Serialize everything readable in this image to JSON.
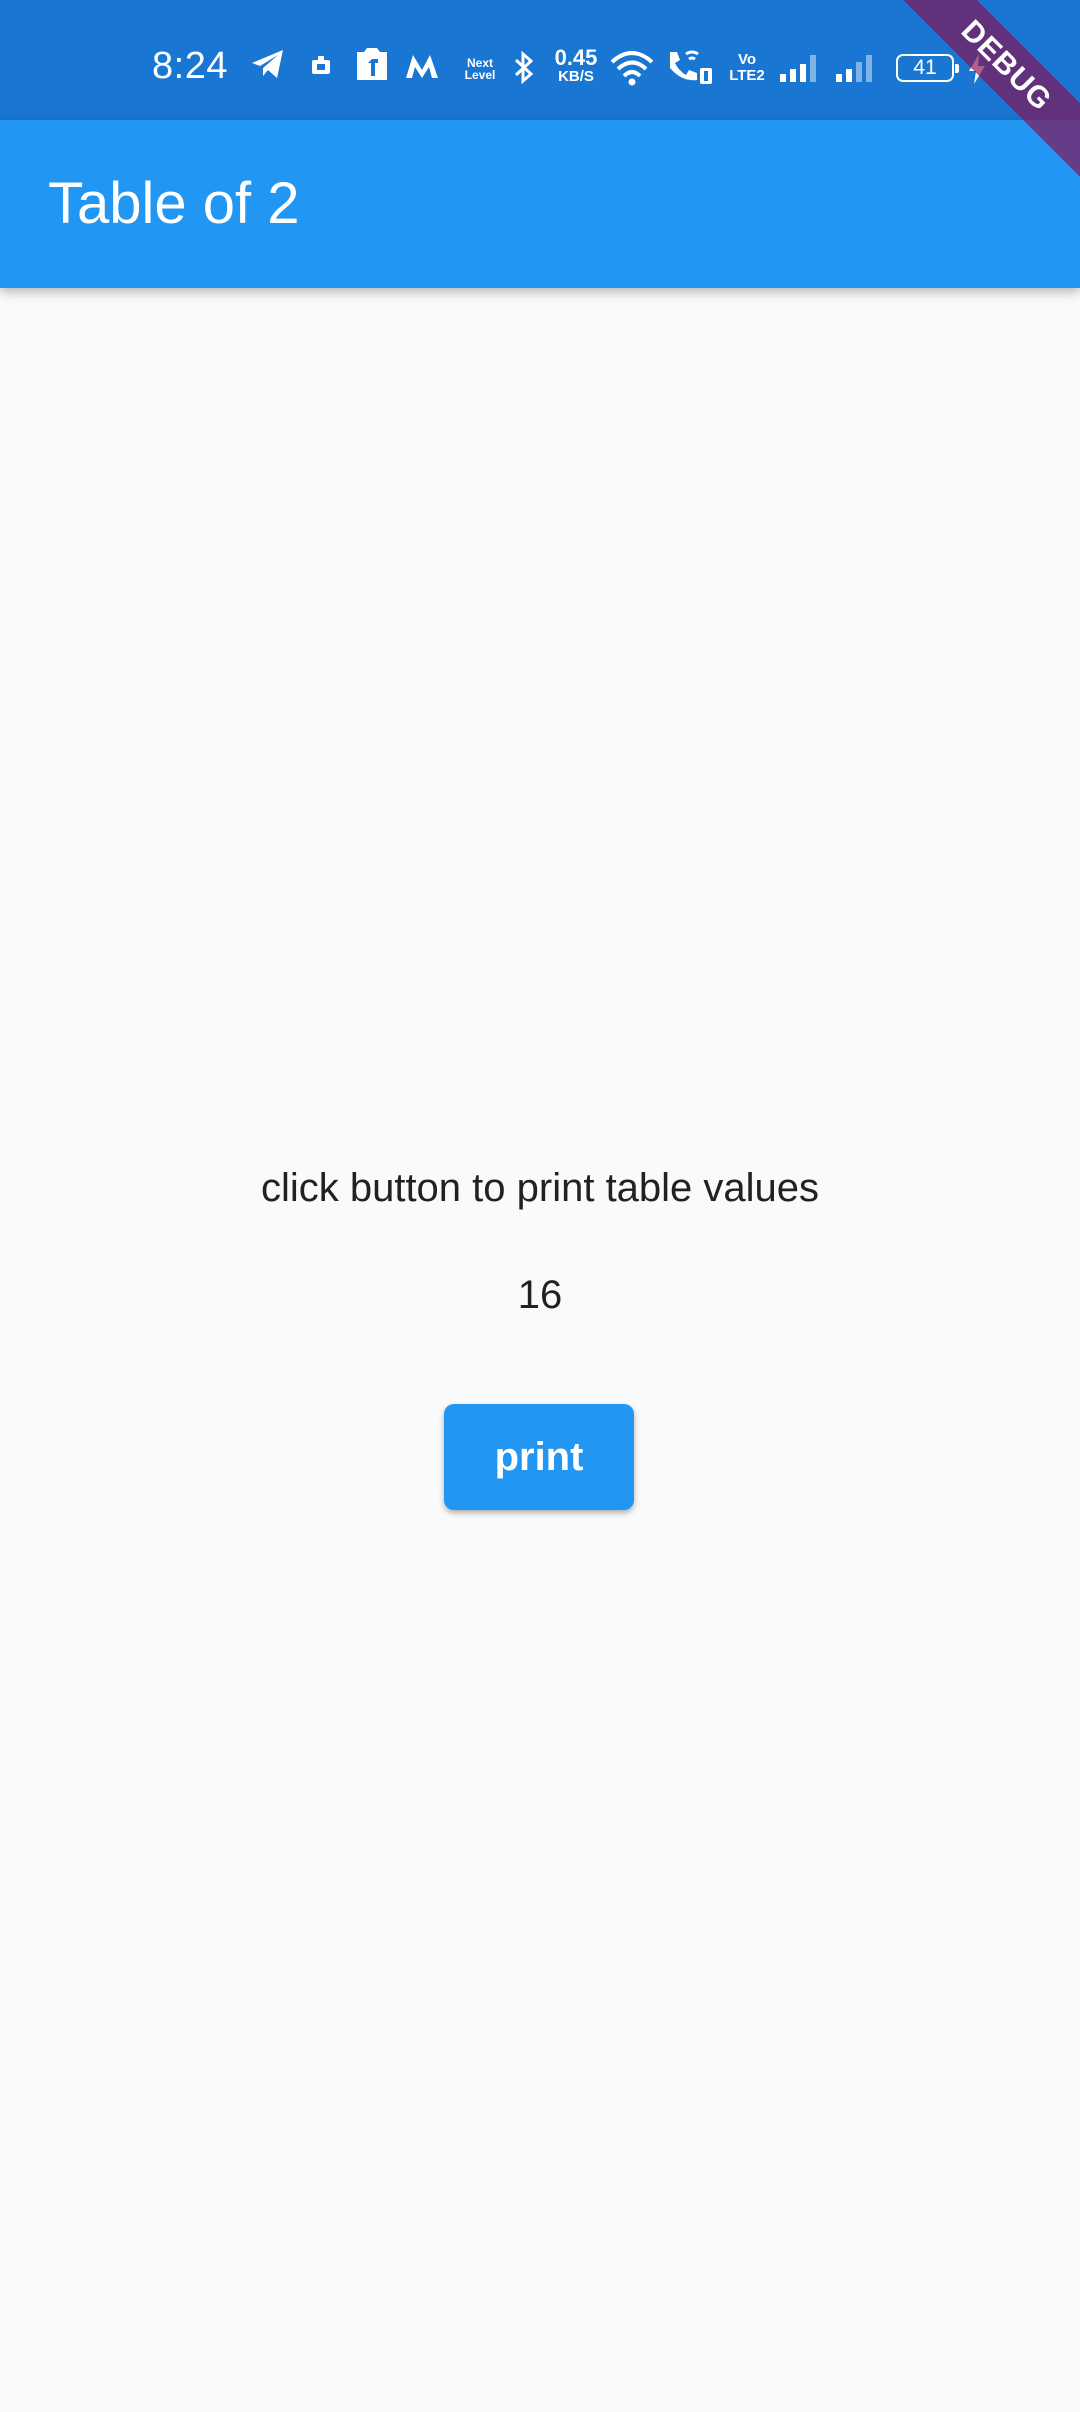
{
  "status_bar": {
    "time": "8:24",
    "net_speed_value": "0.45",
    "net_speed_unit": "KB/S",
    "next_level_line1": "Next",
    "next_level_line2": "Level",
    "volte_line1": "Vo",
    "volte_line2": "LTE2",
    "battery_level": "41",
    "icons": [
      "telegram-icon",
      "notification-icon",
      "app-icon",
      "myntra-icon",
      "next-level-icon",
      "bluetooth-icon",
      "wifi-icon",
      "wifi-calling-icon",
      "signal-icon",
      "signal-icon",
      "battery-icon",
      "charging-icon"
    ]
  },
  "app_bar": {
    "title": "Table of 2"
  },
  "debug_banner": {
    "label": "DEBUG"
  },
  "main": {
    "instruction": "click  button to print table values",
    "value": "16",
    "print_button_label": "print"
  },
  "colors": {
    "status_bar": "#1976d2",
    "app_bar": "#2196f3",
    "background": "#fafafa",
    "button": "#2196f3",
    "debug_ribbon": "#880e4f"
  }
}
